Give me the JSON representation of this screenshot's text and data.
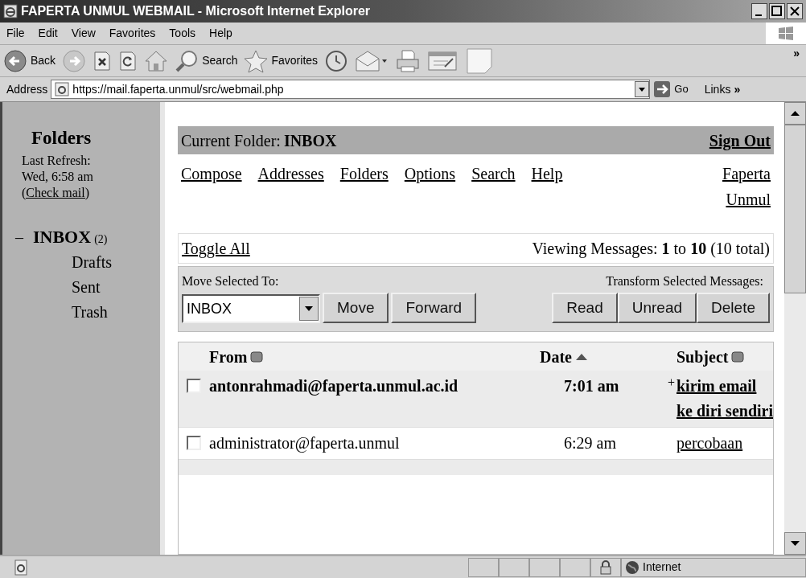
{
  "window": {
    "title": "FAPERTA UNMUL WEBMAIL - Microsoft Internet Explorer"
  },
  "menu": [
    "File",
    "Edit",
    "View",
    "Favorites",
    "Tools",
    "Help"
  ],
  "toolbar": [
    {
      "kind": "back",
      "label": "Back"
    },
    {
      "kind": "forward"
    },
    {
      "kind": "stop"
    },
    {
      "kind": "refresh"
    },
    {
      "kind": "home"
    },
    {
      "kind": "search",
      "label": "Search"
    },
    {
      "kind": "favorites",
      "label": "Favorites"
    },
    {
      "kind": "history"
    },
    {
      "kind": "mail"
    },
    {
      "kind": "print"
    },
    {
      "kind": "edit"
    },
    {
      "kind": "note"
    }
  ],
  "toolbar_more": "»",
  "address": {
    "label": "Address",
    "url": "https://mail.faperta.unmul/src/webmail.php",
    "go": "Go",
    "links": "Links",
    "links_more": "»"
  },
  "sidebar": {
    "title": "Folders",
    "refresh_label": "Last Refresh:",
    "refresh_time": "Wed, 6:58 am",
    "check_mail": "(Check mail)",
    "folders": [
      {
        "name": "INBOX",
        "toggle": "–",
        "count": "(2)",
        "unread": true,
        "children": [
          {
            "name": "Drafts"
          },
          {
            "name": "Sent"
          },
          {
            "name": "Trash"
          }
        ]
      }
    ]
  },
  "main": {
    "current_folder_label": "Current Folder:",
    "current_folder": "INBOX",
    "sign_out": "Sign Out",
    "nav": [
      "Compose",
      "Addresses",
      "Folders",
      "Options",
      "Search",
      "Help"
    ],
    "brand_link": "Faperta Unmul",
    "toggle_all": "Toggle All",
    "viewing": "Viewing Messages: **1** to **10** (10 total)",
    "move_label": "Move Selected To:",
    "move_select": "INBOX",
    "move_buttons": [
      "Move",
      "Forward"
    ],
    "transform_label": "Transform Selected Messages:",
    "transform_buttons": [
      "Read",
      "Unread",
      "Delete"
    ]
  },
  "table": {
    "columns": [
      {
        "label": "From",
        "sorted": false
      },
      {
        "label": "Date",
        "sorted": true
      },
      {
        "label": "Subject",
        "sorted": false
      }
    ],
    "rows": [
      {
        "from": "antonrahmadi@faperta.unmul.ac.id",
        "date": "7:01 am",
        "flag": "+",
        "subject": "kirim email ke diri sendiri",
        "unread": true,
        "checked": false
      },
      {
        "from": "administrator@faperta.unmul",
        "date": "6:29 am",
        "subject": "percobaan",
        "unread": false,
        "checked": false
      }
    ]
  },
  "status": {
    "zone": "Internet",
    "secure": true
  }
}
